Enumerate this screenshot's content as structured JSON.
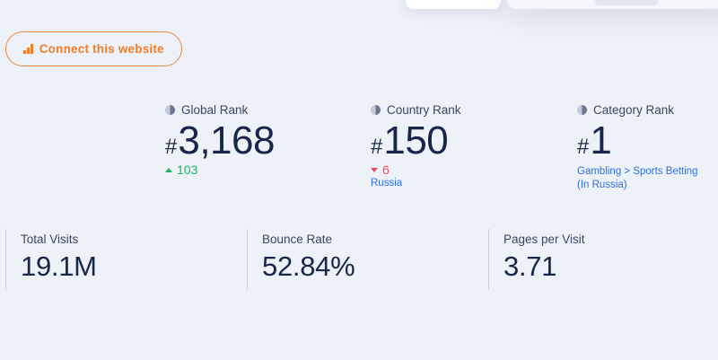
{
  "connect_button": {
    "label": "Connect this website",
    "icon": "bar-chart-icon",
    "color": "#f07d29"
  },
  "ranks": {
    "global": {
      "label": "Global Rank",
      "hash": "#",
      "value": "3,168",
      "change": "103",
      "direction": "up"
    },
    "country": {
      "label": "Country Rank",
      "hash": "#",
      "value": "150",
      "change": "6",
      "direction": "down",
      "country": "Russia"
    },
    "category": {
      "label": "Category Rank",
      "hash": "#",
      "value": "1",
      "category_line1": "Gambling > Sports Betting",
      "category_line2": "(In Russia)"
    }
  },
  "metrics": {
    "total_visits": {
      "label": "Total Visits",
      "value": "19.1M"
    },
    "bounce_rate": {
      "label": "Bounce Rate",
      "value": "52.84%"
    },
    "pages_per_visit": {
      "label": "Pages per Visit",
      "value": "3.71"
    }
  },
  "colors": {
    "up": "#1fb365",
    "down": "#ea4d5b",
    "link": "#2f6fe4",
    "background": "#edf1f8"
  }
}
